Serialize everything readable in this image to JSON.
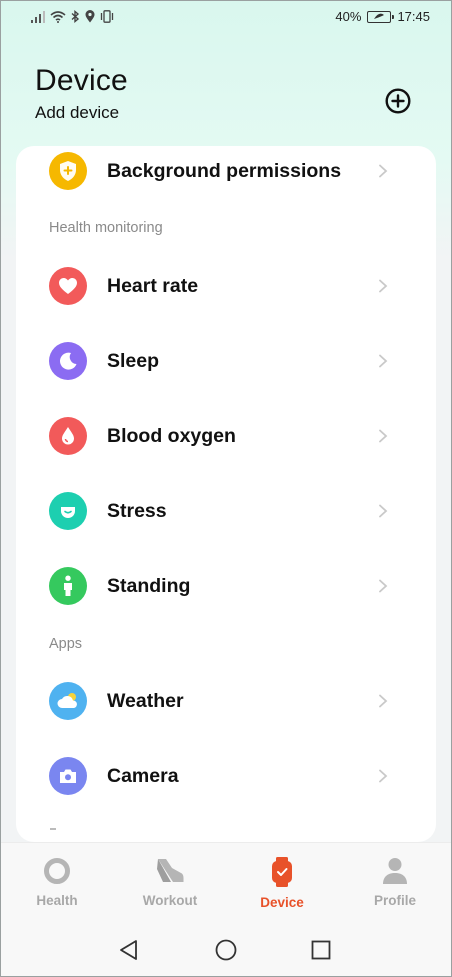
{
  "status_bar": {
    "battery_percent": "40%",
    "time": "17:45",
    "icons": [
      "signal-icon",
      "wifi-icon",
      "bluetooth-icon",
      "location-icon",
      "vibrate-icon",
      "battery-icon"
    ]
  },
  "header": {
    "title": "Device",
    "subtitle": "Add device",
    "add_icon": "plus-circle-icon"
  },
  "list": {
    "background_permissions": {
      "label": "Background permissions",
      "icon": "shield-icon",
      "color": "#F6B800"
    },
    "health_section": "Health monitoring",
    "heart_rate": {
      "label": "Heart rate",
      "icon": "heart-icon",
      "color": "#F25A5A"
    },
    "sleep": {
      "label": "Sleep",
      "icon": "moon-icon",
      "color": "#8B6CF2"
    },
    "blood_oxygen": {
      "label": "Blood oxygen",
      "icon": "drop-icon",
      "color": "#F25A5A"
    },
    "stress": {
      "label": "Stress",
      "icon": "face-icon",
      "color": "#1DCFB0"
    },
    "standing": {
      "label": "Standing",
      "icon": "person-icon",
      "color": "#35C95E"
    },
    "apps_section": "Apps",
    "weather": {
      "label": "Weather",
      "icon": "cloud-sun-icon",
      "color": "#4FB2F0"
    },
    "camera": {
      "label": "Camera",
      "icon": "camera-icon",
      "color": "#7A86F0"
    }
  },
  "bottom_nav": {
    "health": "Health",
    "workout": "Workout",
    "device": "Device",
    "profile": "Profile",
    "active": "Device",
    "active_color": "#E8522A"
  }
}
